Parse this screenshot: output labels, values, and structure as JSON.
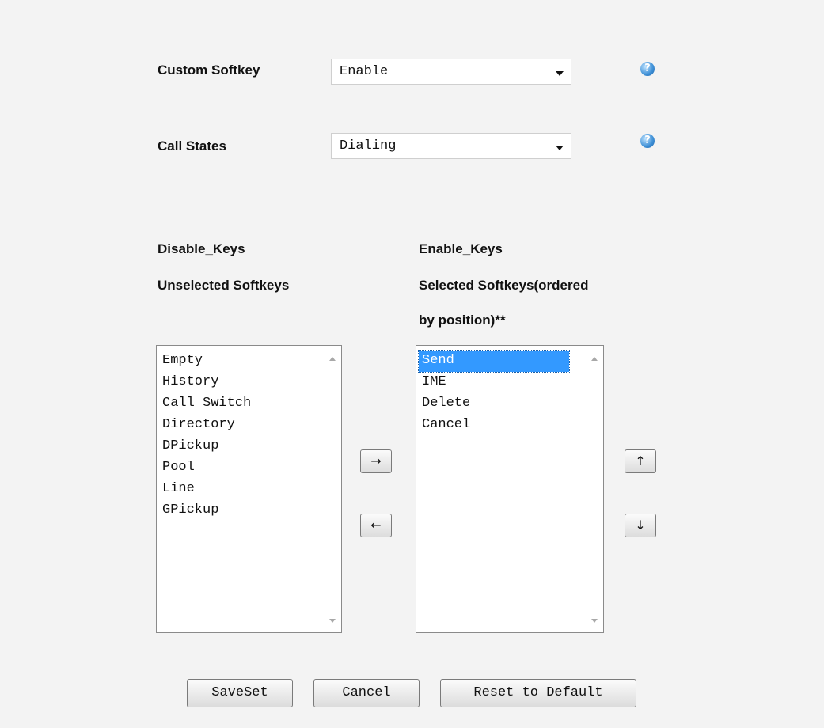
{
  "custom_softkey": {
    "label": "Custom Softkey",
    "value": "Enable",
    "help": "?"
  },
  "call_states": {
    "label": "Call States",
    "value": "Dialing",
    "help": "?"
  },
  "disabled_column": {
    "heading": "Disable_Keys",
    "subheading": "Unselected Softkeys",
    "items": [
      "Empty",
      "History",
      "Call Switch",
      "Directory",
      "DPickup",
      "Pool",
      "Line",
      "GPickup"
    ]
  },
  "enabled_column": {
    "heading": "Enable_Keys",
    "subheading_line1": "Selected Softkeys(ordered",
    "subheading_line2": "by position)**",
    "items": [
      "Send",
      "IME",
      "Delete",
      "Cancel"
    ],
    "selected_item": "Send"
  },
  "move_buttons": {
    "add": "→",
    "remove": "←",
    "up": "↑",
    "down": "↓"
  },
  "footer": {
    "save": "SaveSet",
    "cancel": "Cancel",
    "reset": "Reset to Default"
  }
}
